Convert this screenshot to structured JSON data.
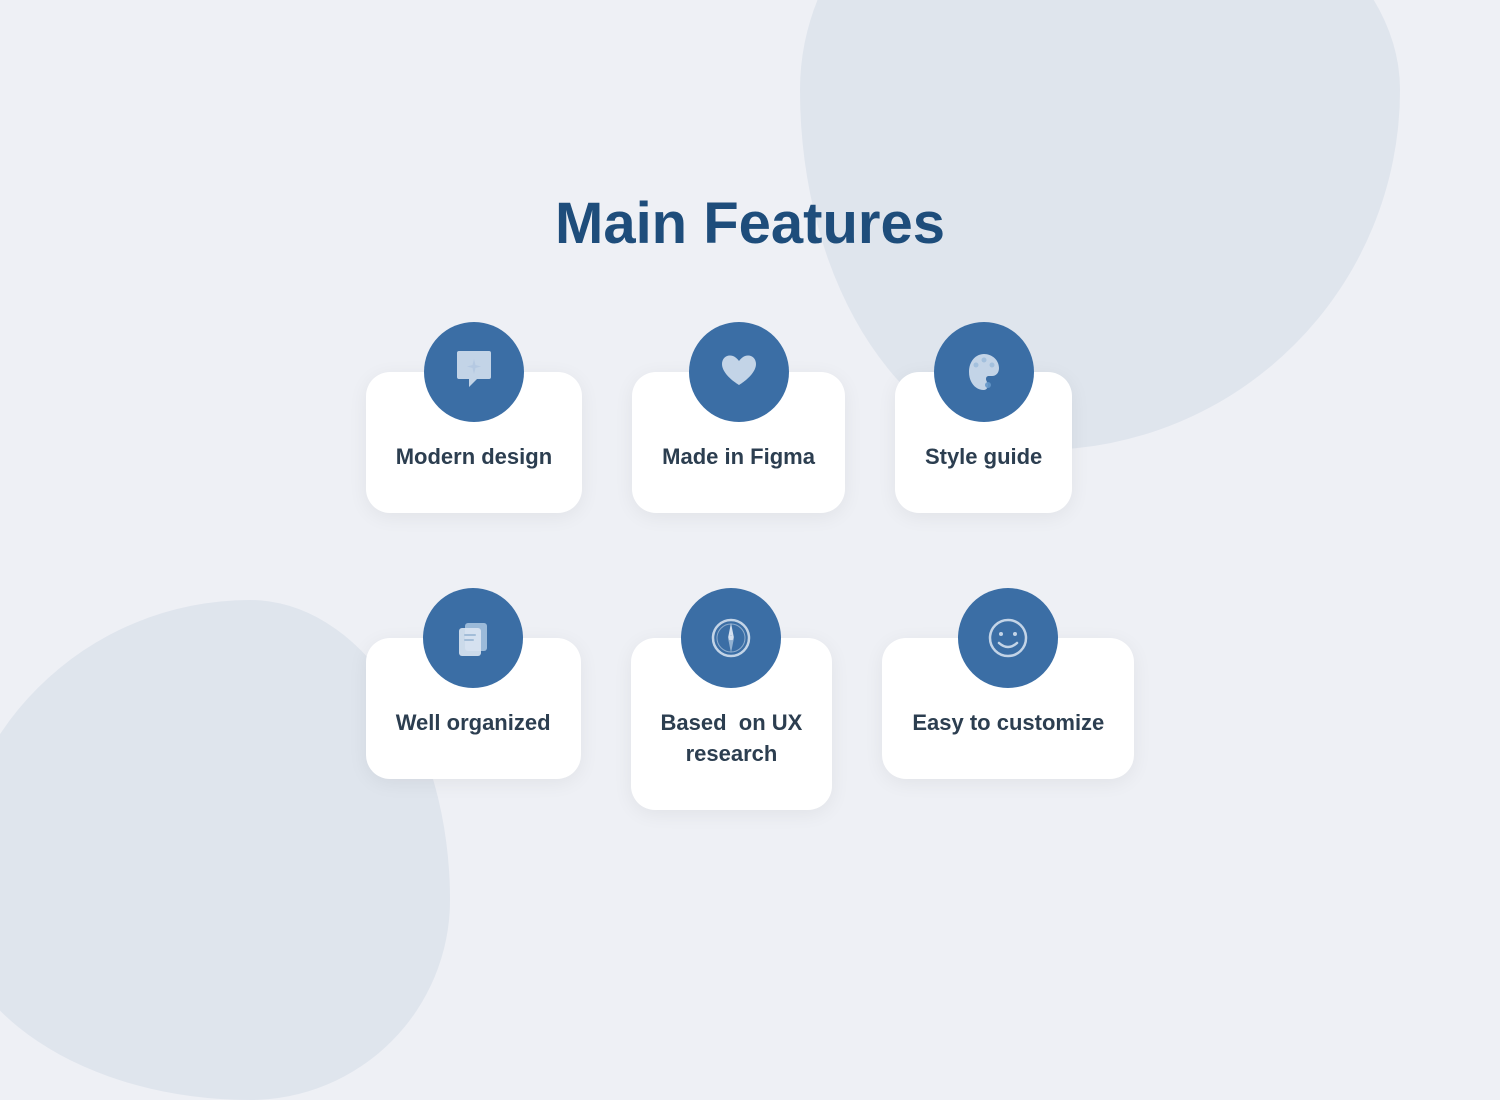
{
  "page": {
    "title": "Main Features",
    "background_color": "#eef0f5",
    "accent_color": "#3b6ea5",
    "title_color": "#1e4d7b"
  },
  "features": [
    {
      "id": "modern-design",
      "label": "Modern design",
      "icon": "sparkle"
    },
    {
      "id": "made-in-figma",
      "label": "Made in Figma",
      "icon": "heart"
    },
    {
      "id": "style-guide",
      "label": "Style guide",
      "icon": "palette"
    },
    {
      "id": "well-organized",
      "label": "Well organized",
      "icon": "layers"
    },
    {
      "id": "based-on-ux",
      "label": "Based  on UX\nresearch",
      "icon": "compass"
    },
    {
      "id": "easy-to-customize",
      "label": "Easy to customize",
      "icon": "smiley"
    }
  ]
}
